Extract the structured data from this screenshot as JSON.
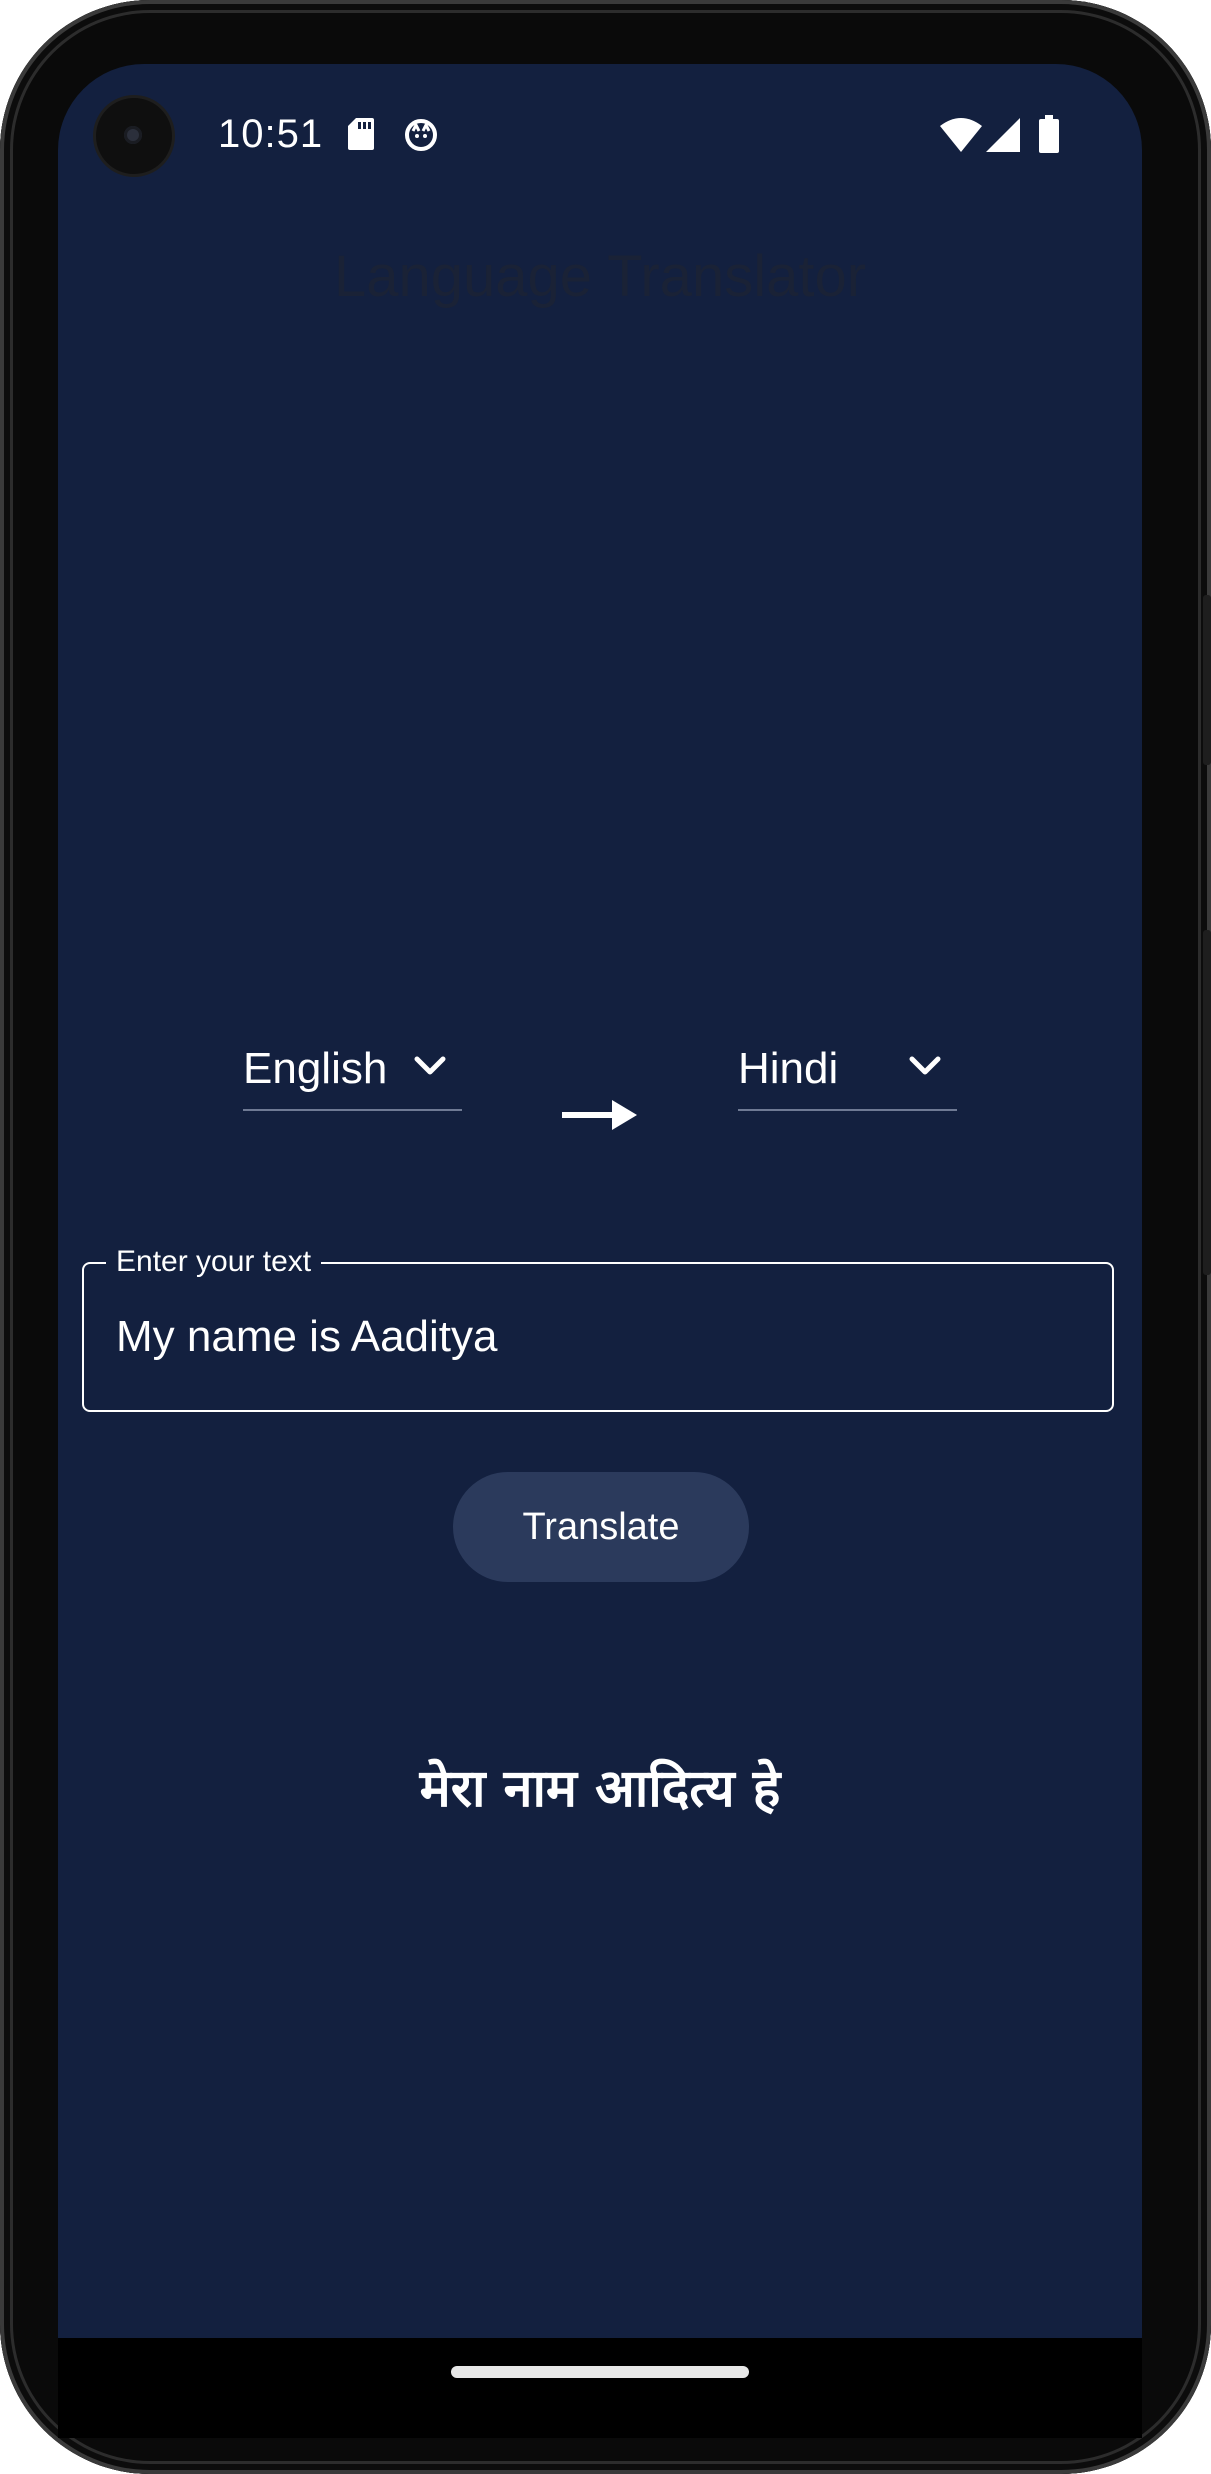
{
  "status_bar": {
    "time": "10:51",
    "icons": [
      "sd-card-icon",
      "notification-icon",
      "wifi-icon",
      "signal-icon",
      "battery-icon"
    ]
  },
  "app": {
    "title": "Language Translator"
  },
  "language_selector": {
    "from": "English",
    "to": "Hindi",
    "arrow_icon": "arrow-right-icon"
  },
  "input": {
    "label": "Enter your text",
    "value": "My name is Aaditya"
  },
  "translate_button": {
    "label": "Translate"
  },
  "output": {
    "text": "मेरा नाम आदित्य हे"
  },
  "colors": {
    "background": "#13203f",
    "button": "#2b3a5c",
    "text": "#ffffff"
  }
}
